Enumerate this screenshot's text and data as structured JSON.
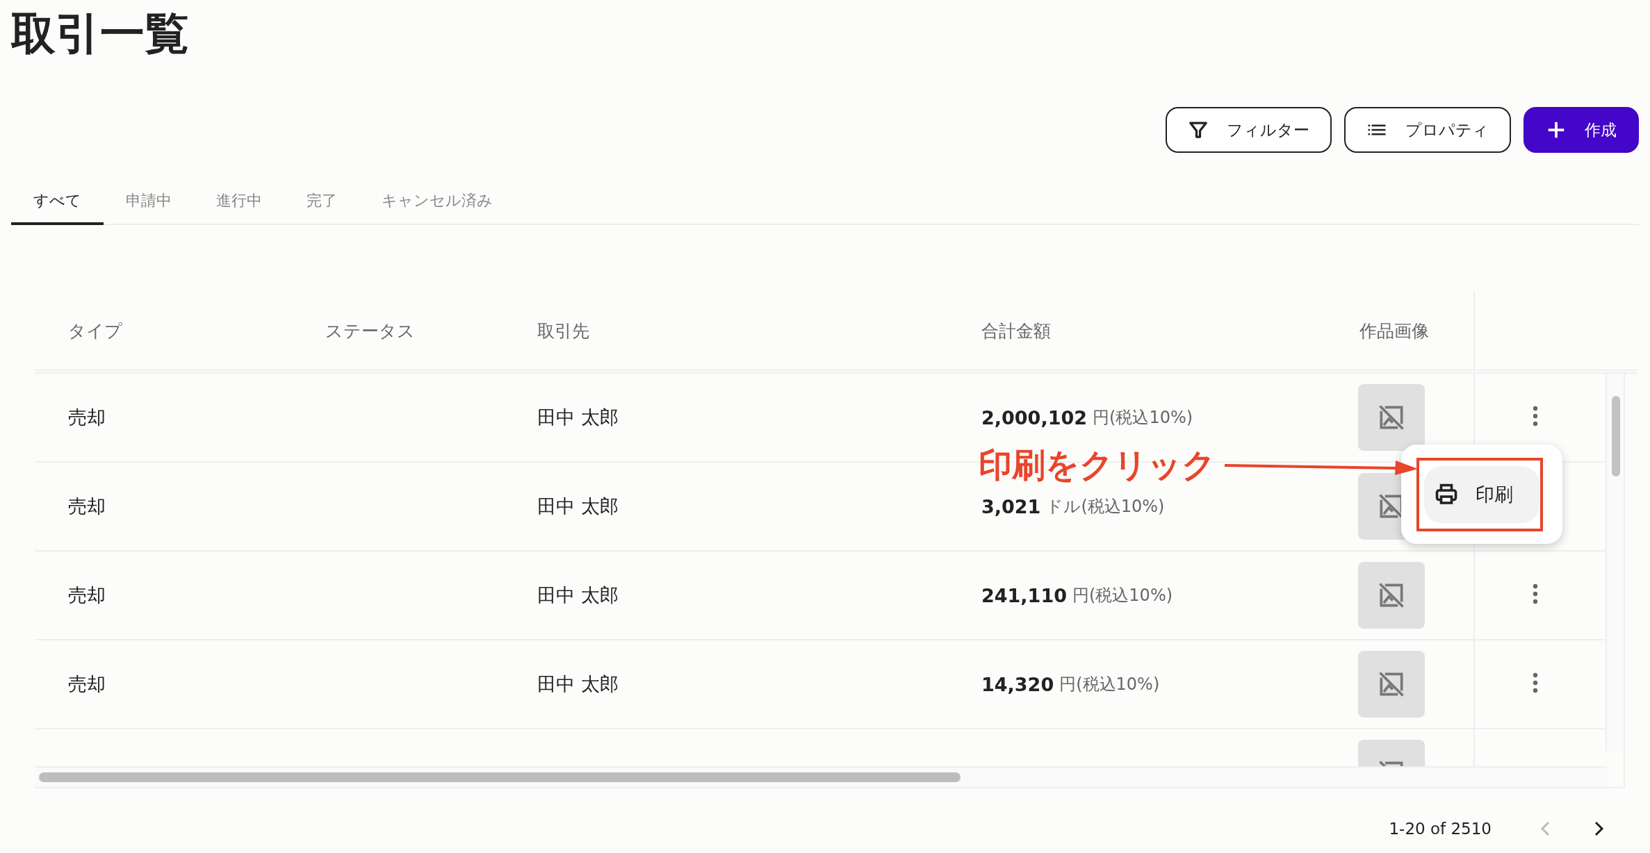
{
  "page": {
    "title": "取引一覧"
  },
  "toolbar": {
    "buttons": [
      {
        "label": "フィルター",
        "kind": "filter"
      },
      {
        "label": "プロパティ",
        "kind": "properties"
      },
      {
        "label": "作成",
        "kind": "create"
      }
    ]
  },
  "tabs": [
    {
      "label": "すべて",
      "selected": true
    },
    {
      "label": "申請中",
      "selected": false
    },
    {
      "label": "進行中",
      "selected": false
    },
    {
      "label": "完了",
      "selected": false
    },
    {
      "label": "キャンセル済み",
      "selected": false
    }
  ],
  "table": {
    "columns": [
      "タイプ",
      "ステータス",
      "取引先",
      "合計金額",
      "作品画像"
    ],
    "rows": [
      {
        "type": "売却",
        "partner": "田中 太郎",
        "amount": "2,000,102",
        "unit": "円(税込10%)"
      },
      {
        "type": "売却",
        "partner": "田中 太郎",
        "amount": "3,021",
        "unit": "ドル(税込10%)"
      },
      {
        "type": "売却",
        "partner": "田中 太郎",
        "amount": "241,110",
        "unit": "円(税込10%)"
      },
      {
        "type": "売却",
        "partner": "田中 太郎",
        "amount": "14,320",
        "unit": "円(税込10%)"
      },
      {
        "clipped": true
      }
    ]
  },
  "context_menu": {
    "items": [
      {
        "label": "印刷",
        "highlighted": true
      }
    ]
  },
  "annotation": {
    "text": "印刷をクリック"
  },
  "pagination": {
    "range": "1-20 of 2510",
    "previous_disabled": true
  }
}
